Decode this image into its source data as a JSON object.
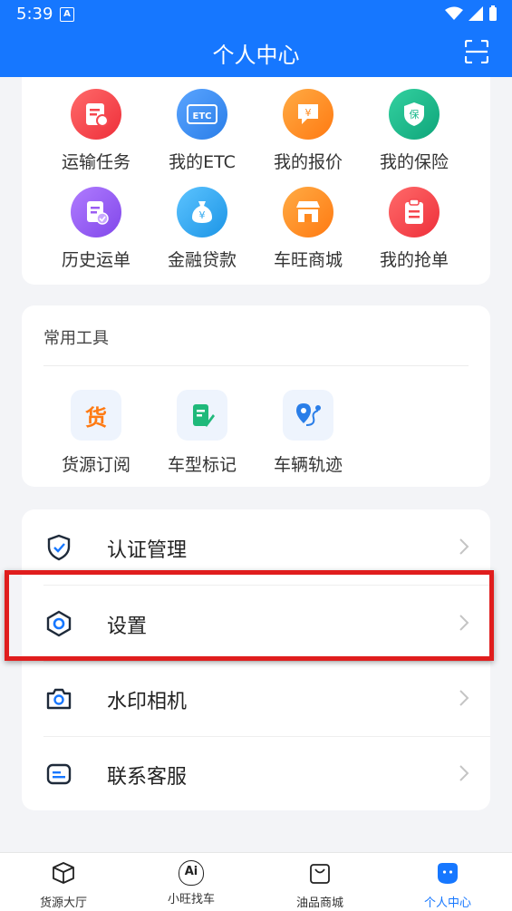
{
  "status_bar": {
    "time": "5:39",
    "notif_letter": "A"
  },
  "header": {
    "title": "个人中心"
  },
  "services": [
    {
      "label": "运输任务",
      "icon": "transport-task-icon",
      "color": "#f5474e"
    },
    {
      "label": "我的ETC",
      "icon": "etc-card-icon",
      "color": "#3a8ef0",
      "badge": "ETC"
    },
    {
      "label": "我的报价",
      "icon": "quote-icon",
      "color": "#ff8a1f",
      "badge": "¥"
    },
    {
      "label": "我的保险",
      "icon": "insurance-shield-icon",
      "color": "#18b88a",
      "badge": "保"
    },
    {
      "label": "历史运单",
      "icon": "history-waybill-icon",
      "color": "#9b5cf2"
    },
    {
      "label": "金融贷款",
      "icon": "money-bag-icon",
      "color": "#2ea8f0",
      "badge": "¥"
    },
    {
      "label": "车旺商城",
      "icon": "shop-store-icon",
      "color": "#ff8a1f"
    },
    {
      "label": "我的抢单",
      "icon": "clipboard-icon",
      "color": "#f5474e"
    }
  ],
  "tools": {
    "title": "常用工具",
    "items": [
      {
        "label": "货源订阅",
        "icon": "cargo-subscribe-icon",
        "glyph": "货"
      },
      {
        "label": "车型标记",
        "icon": "vehicle-mark-icon"
      },
      {
        "label": "车辆轨迹",
        "icon": "vehicle-track-icon"
      }
    ]
  },
  "menu": [
    {
      "label": "认证管理",
      "icon": "shield-check-icon"
    },
    {
      "label": "设置",
      "icon": "settings-hexagon-icon"
    },
    {
      "label": "水印相机",
      "icon": "camera-icon"
    },
    {
      "label": "联系客服",
      "icon": "customer-service-icon"
    }
  ],
  "tabbar": [
    {
      "label": "货源大厅",
      "icon": "cube-box-icon"
    },
    {
      "label": "小旺找车",
      "icon": "ai-assistant-icon",
      "glyph": "Ai"
    },
    {
      "label": "油品商城",
      "icon": "shopping-bag-icon"
    },
    {
      "label": "个人中心",
      "icon": "profile-face-icon",
      "active": true
    }
  ],
  "colors": {
    "brand": "#1677ff",
    "highlight": "#e01d1d"
  }
}
